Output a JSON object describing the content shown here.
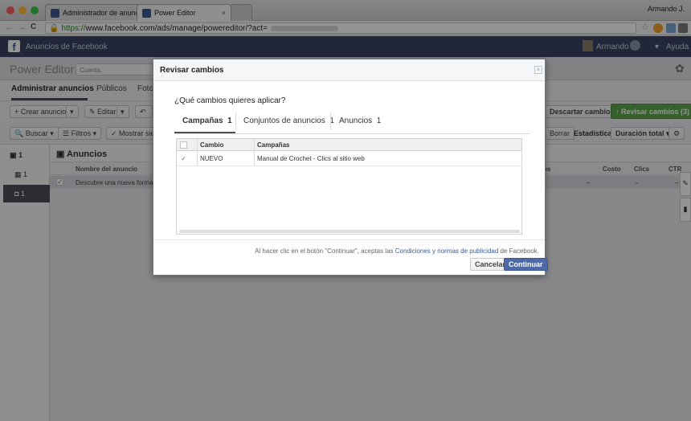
{
  "browser": {
    "tabs": [
      {
        "label": "Administrador de anuncios",
        "close": "×"
      },
      {
        "label": "Power Editor",
        "close": "×"
      }
    ],
    "user_chip": "Armando J.",
    "url_scheme": "https://",
    "url_rest": "www.facebook.com/ads/manage/powereditor/?act=",
    "nav": {
      "back": "←",
      "forward": "→",
      "reload": "C"
    }
  },
  "fb_header": {
    "logo": "f",
    "title": "Anuncios de Facebook",
    "user": "Armando",
    "help": "Ayuda",
    "menu": "▾"
  },
  "power_editor": {
    "title": "Power Editor",
    "account_label": "Cuenta:",
    "tabs": [
      "Administrar anuncios",
      "Públicos",
      "Foto"
    ],
    "toolbar": {
      "create": "+ Crear anuncio",
      "edit": "Editar",
      "discard": "Descartar cambios",
      "review": "↑ Revisar cambios (3)"
    },
    "toolbar2": {
      "search": "Buscar",
      "filters": "Filtros",
      "show": "Mostrar siem",
      "delete": "Borrar",
      "stats_label": "Estadísticas:",
      "stats_value": "Duración total"
    },
    "left_counts": [
      "1",
      "1",
      "1"
    ],
    "section_title": "Anuncios",
    "column_headers": [
      "Nombre del anuncio",
      "os",
      "Costo",
      "Clics",
      "CTR"
    ],
    "row": {
      "name": "Descubre una nueva forma de te",
      "costo": "–",
      "clics": "–",
      "ctr": "–"
    }
  },
  "modal": {
    "title": "Revisar cambios",
    "close": "×",
    "question": "¿Qué cambios quieres aplicar?",
    "tabs": [
      {
        "label": "Campañas",
        "count": "1"
      },
      {
        "label": "Conjuntos de anuncios",
        "count": "1"
      },
      {
        "label": "Anuncios",
        "count": "1"
      }
    ],
    "table": {
      "headers": [
        "Cambio",
        "Campañas"
      ],
      "rows": [
        {
          "checked": "✓",
          "change": "NUEVO",
          "campaign": "Manual de Crochet - Clics al sitio web"
        }
      ]
    },
    "disclaimer_before": "Al hacer clic en el botón \"Continuar\", aceptas las ",
    "disclaimer_link": "Condiciones y normas de publicidad",
    "disclaimer_after": " de Facebook.",
    "cancel": "Cancelar",
    "continue": "Continuar"
  },
  "colors": {
    "facebook_blue": "#3b5998",
    "header_bar": "#394363",
    "review_green": "#5ea84e"
  }
}
